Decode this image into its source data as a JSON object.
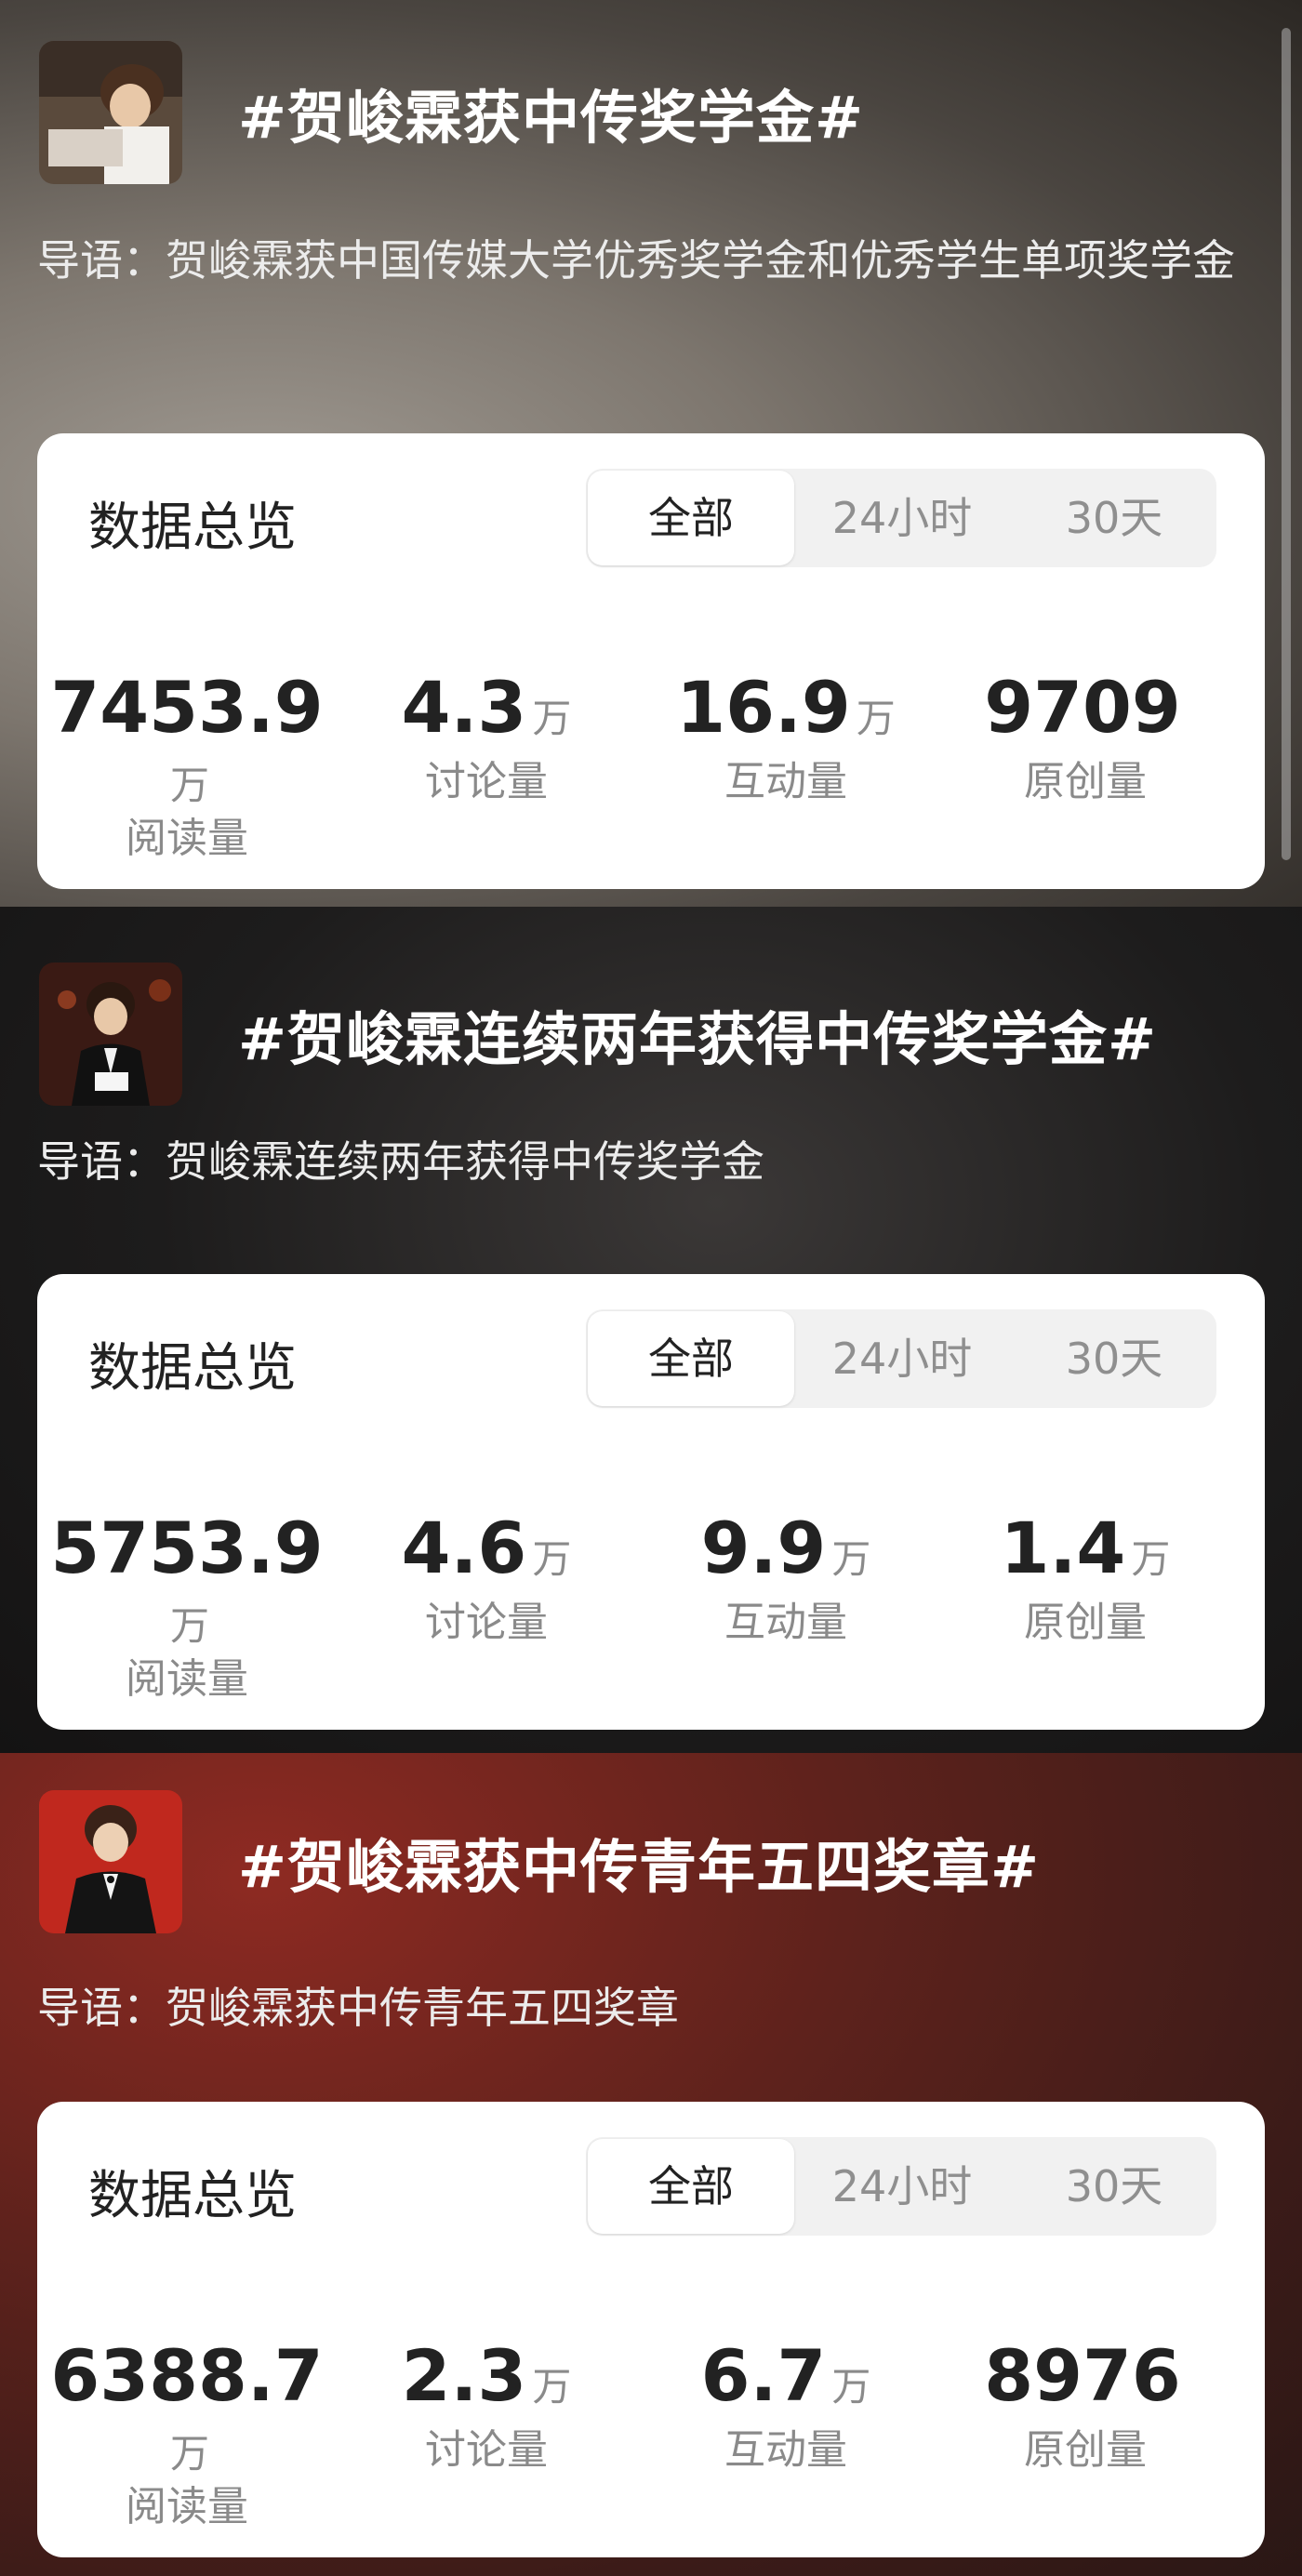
{
  "topics": [
    {
      "title": "#贺峻霖获中传奖学金#",
      "lead": "导语：贺峻霖获中国传媒大学优秀奖学金和优秀学生单项奖学金",
      "card_title": "数据总览",
      "tabs": [
        "全部",
        "24小时",
        "30天"
      ],
      "active_tab": "全部",
      "stats": [
        {
          "value": "7453.9",
          "unit": "万",
          "label": "阅读量"
        },
        {
          "value": "4.3",
          "unit": "万",
          "label": "讨论量"
        },
        {
          "value": "16.9",
          "unit": "万",
          "label": "互动量"
        },
        {
          "value": "9709",
          "unit": "",
          "label": "原创量"
        }
      ]
    },
    {
      "title": "#贺峻霖连续两年获得中传奖学金#",
      "lead": "导语：贺峻霖连续两年获得中传奖学金",
      "card_title": "数据总览",
      "tabs": [
        "全部",
        "24小时",
        "30天"
      ],
      "active_tab": "全部",
      "stats": [
        {
          "value": "5753.9",
          "unit": "万",
          "label": "阅读量"
        },
        {
          "value": "4.6",
          "unit": "万",
          "label": "讨论量"
        },
        {
          "value": "9.9",
          "unit": "万",
          "label": "互动量"
        },
        {
          "value": "1.4",
          "unit": "万",
          "label": "原创量"
        }
      ]
    },
    {
      "title": "#贺峻霖获中传青年五四奖章#",
      "lead": "导语：贺峻霖获中传青年五四奖章",
      "card_title": "数据总览",
      "tabs": [
        "全部",
        "24小时",
        "30天"
      ],
      "active_tab": "全部",
      "stats": [
        {
          "value": "6388.7",
          "unit": "万",
          "label": "阅读量"
        },
        {
          "value": "2.3",
          "unit": "万",
          "label": "讨论量"
        },
        {
          "value": "6.7",
          "unit": "万",
          "label": "互动量"
        },
        {
          "value": "8976",
          "unit": "",
          "label": "原创量"
        }
      ]
    }
  ]
}
